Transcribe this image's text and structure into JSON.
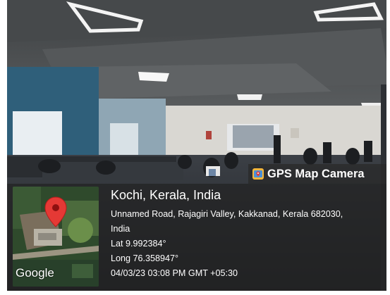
{
  "overlay": {
    "app_name": "GPS Map Camera",
    "app_icon": "map-camera-icon",
    "location_title": "Kochi, Kerala, India",
    "address_line1": "Unnamed Road, Rajagiri Valley, Kakkanad, Kerala 682030,",
    "address_line2": "India",
    "latitude": "Lat 9.992384°",
    "longitude": "Long 76.358947°",
    "datetime": "04/03/23 03:08 PM GMT +05:30",
    "map_attribution": "Google",
    "map_marker_icon": "red-location-pin-icon"
  },
  "colors": {
    "overlay_bg": "#232323",
    "pin": "#e53935",
    "text": "#ffffff"
  }
}
